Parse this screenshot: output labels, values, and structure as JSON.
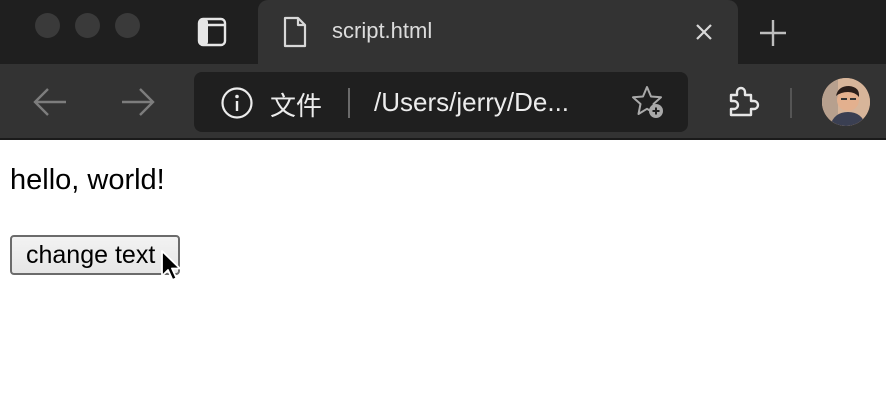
{
  "window": {
    "controls": [
      "close",
      "minimize",
      "zoom"
    ]
  },
  "tab": {
    "title": "script.html",
    "icon": "page-icon"
  },
  "toolbar": {
    "back_icon": "back-arrow-icon",
    "forward_icon": "forward-arrow-icon",
    "address": {
      "origin_label": "文件",
      "url_text": "/Users/jerry/De..."
    }
  },
  "page": {
    "heading_text": "hello, world!",
    "button_label": "change text"
  },
  "colors": {
    "titlebar": "#1f1f1f",
    "tab_active": "#333333",
    "toolbar": "#333333",
    "omnibox": "#1f1f1f",
    "content_bg": "#ffffff"
  }
}
